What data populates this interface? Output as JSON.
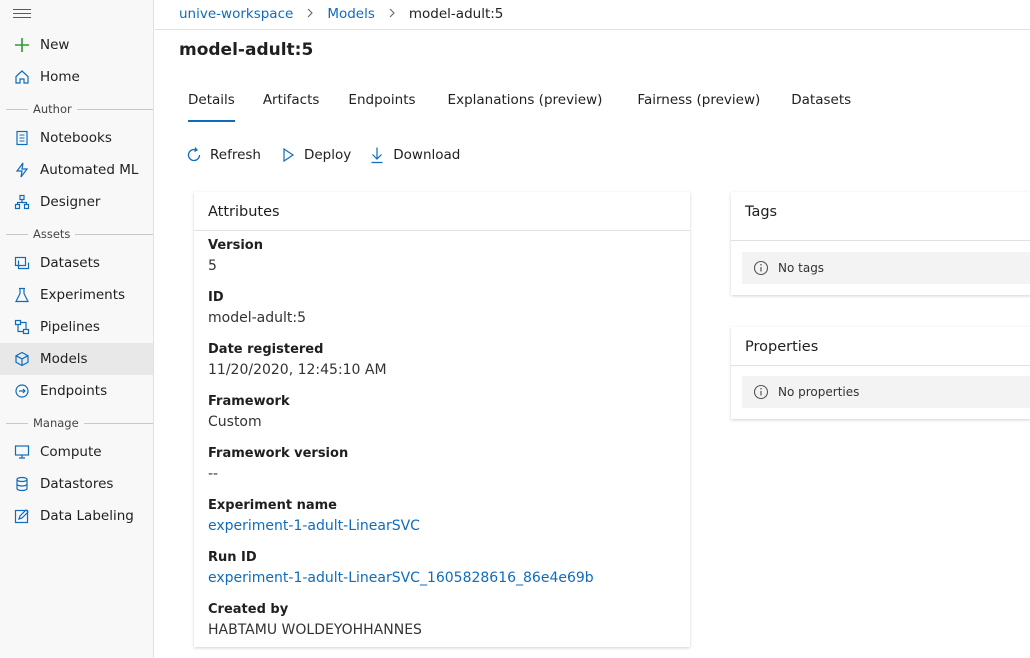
{
  "sidebar": {
    "top_items": [
      {
        "label": "New",
        "icon": "plus-icon"
      },
      {
        "label": "Home",
        "icon": "home-icon"
      }
    ],
    "sections": [
      {
        "label": "Author",
        "items": [
          {
            "label": "Notebooks",
            "icon": "notebook-icon"
          },
          {
            "label": "Automated ML",
            "icon": "automated-ml-icon"
          },
          {
            "label": "Designer",
            "icon": "designer-icon"
          }
        ]
      },
      {
        "label": "Assets",
        "items": [
          {
            "label": "Datasets",
            "icon": "datasets-icon"
          },
          {
            "label": "Experiments",
            "icon": "flask-icon"
          },
          {
            "label": "Pipelines",
            "icon": "pipelines-icon"
          },
          {
            "label": "Models",
            "icon": "cube-icon",
            "active": true
          },
          {
            "label": "Endpoints",
            "icon": "endpoints-icon"
          }
        ]
      },
      {
        "label": "Manage",
        "items": [
          {
            "label": "Compute",
            "icon": "monitor-icon"
          },
          {
            "label": "Datastores",
            "icon": "database-icon"
          },
          {
            "label": "Data Labeling",
            "icon": "edit-icon"
          }
        ]
      }
    ]
  },
  "breadcrumb": {
    "workspace": "unive-workspace",
    "models": "Models",
    "current": "model-adult:5"
  },
  "page_title": "model-adult:5",
  "tabs": [
    {
      "label": "Details",
      "active": true
    },
    {
      "label": "Artifacts"
    },
    {
      "label": "Endpoints"
    },
    {
      "label": "Explanations (preview)"
    },
    {
      "label": "Fairness (preview)"
    },
    {
      "label": "Datasets"
    }
  ],
  "toolbar": {
    "refresh": "Refresh",
    "deploy": "Deploy",
    "download": "Download"
  },
  "attributes": {
    "title": "Attributes",
    "items": [
      {
        "label": "Version",
        "value": "5"
      },
      {
        "label": "ID",
        "value": "model-adult:5"
      },
      {
        "label": "Date registered",
        "value": "11/20/2020, 12:45:10 AM"
      },
      {
        "label": "Framework",
        "value": "Custom"
      },
      {
        "label": "Framework version",
        "value": "--"
      },
      {
        "label": "Experiment name",
        "value": "experiment-1-adult-LinearSVC",
        "link": true
      },
      {
        "label": "Run ID",
        "value": "experiment-1-adult-LinearSVC_1605828616_86e4e69b",
        "link": true
      },
      {
        "label": "Created by",
        "value": "HABTAMU WOLDEYOHHANNES"
      }
    ]
  },
  "tags": {
    "title": "Tags",
    "empty_text": "No tags"
  },
  "properties": {
    "title": "Properties",
    "empty_text": "No properties"
  },
  "colors": {
    "accent": "#0f6cbd",
    "sidebar_bg": "#f8f8f8",
    "active_item_bg": "#e8e8e8"
  }
}
